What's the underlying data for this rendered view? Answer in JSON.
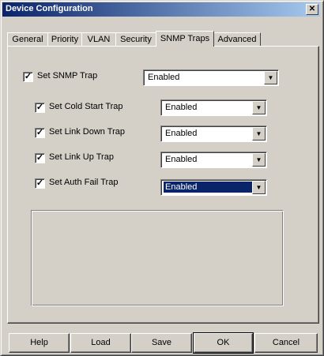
{
  "window": {
    "title": "Device Configuration"
  },
  "tabs": [
    "General",
    "Priority",
    "VLAN",
    "Security",
    "SNMP Traps",
    "Advanced"
  ],
  "active_tab": "SNMP Traps",
  "master": {
    "label": "Set SNMP Trap",
    "checked": true,
    "value": "Enabled"
  },
  "traps": [
    {
      "label": "Set Cold Start Trap",
      "checked": true,
      "value": "Enabled"
    },
    {
      "label": "Set Link Down Trap",
      "checked": true,
      "value": "Enabled"
    },
    {
      "label": "Set Link Up Trap",
      "checked": true,
      "value": "Enabled"
    },
    {
      "label": "Set Auth Fail Trap",
      "checked": true,
      "value": "Enabled",
      "focused": true
    }
  ],
  "buttons": {
    "help": "Help",
    "load": "Load",
    "save": "Save",
    "ok": "OK",
    "cancel": "Cancel"
  },
  "glyphs": {
    "close": "✕",
    "check": "✓",
    "dropdown": "▼"
  },
  "colors": {
    "titlebar_start": "#0a246a",
    "titlebar_end": "#a6caf0",
    "face": "#d4d0c8",
    "selection": "#0a246a"
  }
}
